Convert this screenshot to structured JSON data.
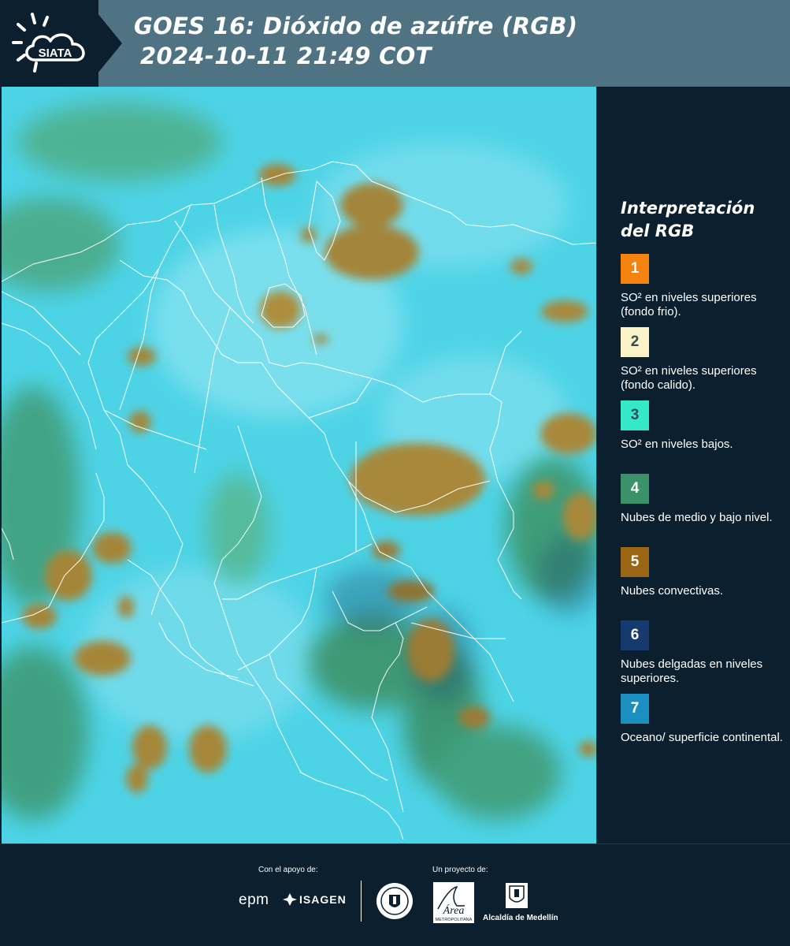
{
  "header": {
    "logo_text": "SIATA",
    "title_line1": "GOES 16: Dióxido de azúfre (RGB)",
    "title_line2": "2024-10-11 21:49 COT"
  },
  "legend": {
    "title_line1": "Interpretación",
    "title_line2": "del RGB",
    "items": [
      {
        "number": "1",
        "color": "#f5830f",
        "label": "SO² en niveles superiores (fondo frio)."
      },
      {
        "number": "2",
        "color": "#fbf3c8",
        "label": "SO² en niveles superiores (fondo calido)."
      },
      {
        "number": "3",
        "color": "#34e8c8",
        "label": "SO² en niveles bajos."
      },
      {
        "number": "4",
        "color": "#3b9268",
        "label": "Nubes de medio y bajo nivel."
      },
      {
        "number": "5",
        "color": "#9a6614",
        "label": "Nubes convectivas."
      },
      {
        "number": "6",
        "color": "#143a6e",
        "label": "Nubes delgadas en niveles superiores."
      },
      {
        "number": "7",
        "color": "#1b8fc0",
        "label": "Oceano/ superficie continental."
      }
    ]
  },
  "footer": {
    "support_label": "Con el apoyo de:",
    "project_label": "Un proyecto de:",
    "epm_text": "epm",
    "isagen_text": "ISAGEN",
    "area_text": "Área",
    "area_subtext": "METROPOLITANA",
    "alcaldia_text": "Alcaldía de Medellín"
  },
  "colors": {
    "background": "#0b1f2e",
    "header_band": "#4f7382",
    "map_base": "#4dd3e6",
    "convective": "#a9893a",
    "mid_low": "#3e9a6a"
  }
}
